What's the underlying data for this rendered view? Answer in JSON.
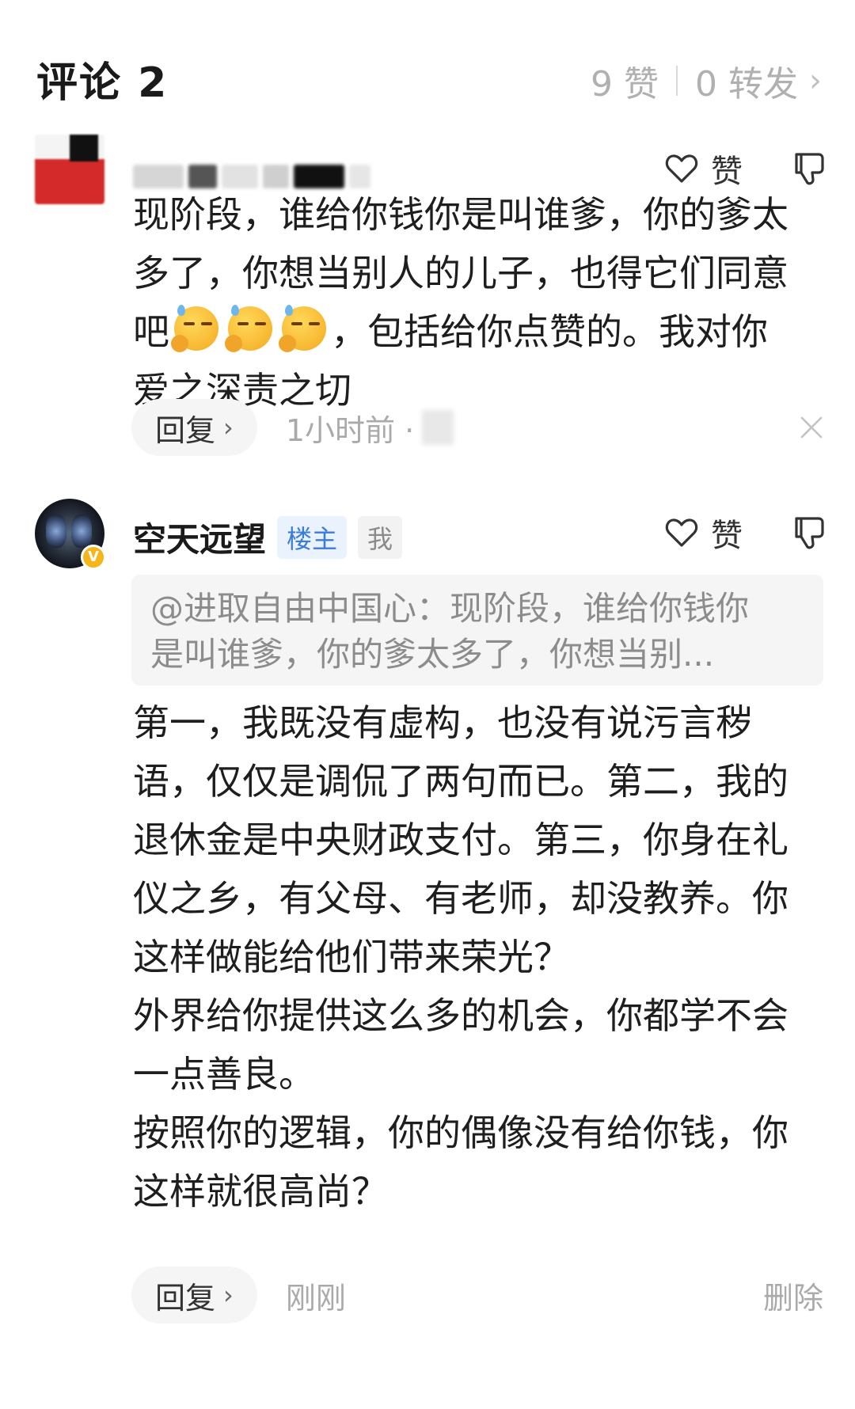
{
  "header": {
    "title": "评论 2",
    "likes": "9 赞",
    "shares": "0 转发"
  },
  "comments": [
    {
      "username": "",
      "avatar": "blurred-avatar",
      "like_label": "赞",
      "lines": [
        "现阶段，谁给你钱你是叫谁爹，你的爹太",
        "多了，你想当别人的儿子，也得它们同意",
        "吧",
        "，包括给你点赞的。我对你",
        "爱之深责之切"
      ],
      "emoji": "smirk-emoji",
      "reply_label": "回复",
      "time": "1小时前 ·",
      "dismiss_icon": "close-icon"
    },
    {
      "username": "空天远望",
      "tag_op": "楼主",
      "tag_me": "我",
      "like_label": "赞",
      "quote_lines": [
        "@进取自由中国心：现阶段，谁给你钱你",
        "是叫谁爹，你的爹太多了，你想当别..."
      ],
      "lines": [
        "第一，我既没有虚构，也没有说污言秽",
        "语，仅仅是调侃了两句而已。第二，我的",
        "退休金是中央财政支付。第三，你身在礼",
        "仪之乡，有父母、有老师，却没教养。你",
        "这样做能给他们带来荣光？",
        "外界给你提供这么多的机会，你都学不会",
        "一点善良。",
        "按照你的逻辑，你的偶像没有给你钱，你",
        "这样就很高尚？"
      ],
      "reply_label": "回复",
      "time": "刚刚",
      "delete_label": "删除"
    }
  ]
}
